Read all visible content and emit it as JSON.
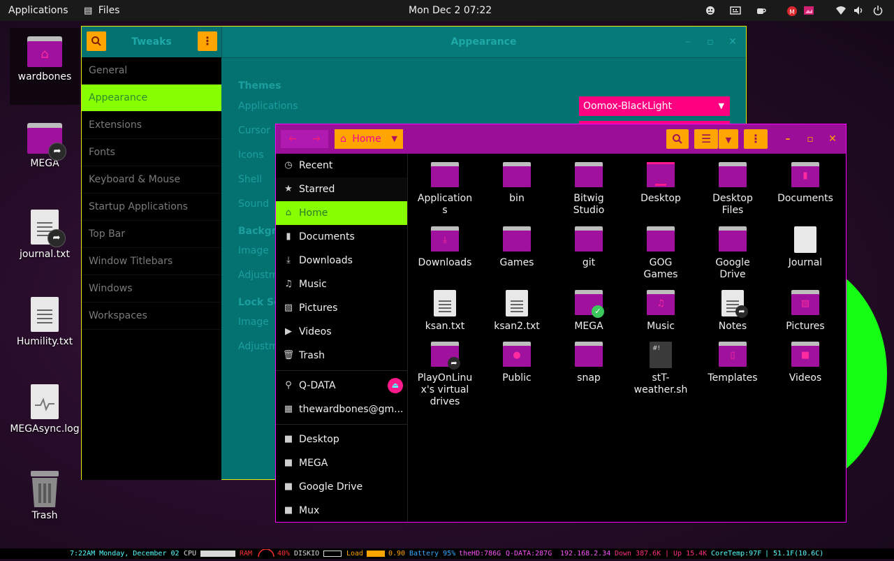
{
  "topbar": {
    "applications": "Applications",
    "files": "Files",
    "clock": "Mon Dec 2  07:22",
    "tray_icons": [
      "emoji-icon",
      "keyboard-icon",
      "coffee-icon",
      "mega-icon",
      "image-icon",
      "wifi-icon",
      "volume-icon",
      "power-icon"
    ]
  },
  "desktop": {
    "icons": [
      {
        "label": "wardbones",
        "kind": "home-folder"
      },
      {
        "label": "MEGA",
        "kind": "folder-link"
      },
      {
        "label": "journal.txt",
        "kind": "text-link"
      },
      {
        "label": "Humility.txt",
        "kind": "text"
      },
      {
        "label": "MEGAsync.log",
        "kind": "log"
      },
      {
        "label": "Trash",
        "kind": "trash"
      }
    ]
  },
  "tweaks": {
    "title": "Tweaks",
    "panel_title": "Appearance",
    "sidebar": [
      "General",
      "Appearance",
      "Extensions",
      "Fonts",
      "Keyboard & Mouse",
      "Startup Applications",
      "Top Bar",
      "Window Titlebars",
      "Windows",
      "Workspaces"
    ],
    "active_index": 1,
    "themes_header": "Themes",
    "rows": [
      "Applications",
      "Cursor",
      "Icons",
      "Shell",
      "Sound"
    ],
    "background_header": "Backgro",
    "background_rows": [
      "Image",
      "Adjustm"
    ],
    "lockscreen_header": "Lock Sc",
    "lockscreen_rows": [
      "Image",
      "Adjustm"
    ],
    "applications_theme": "Oomox-BlackLight"
  },
  "files": {
    "path_label": "Home",
    "sidebar": [
      {
        "label": "Recent",
        "icon": "clock-icon"
      },
      {
        "label": "Starred",
        "icon": "star-icon"
      },
      {
        "label": "Home",
        "icon": "home-icon",
        "active": true
      },
      {
        "label": "Documents",
        "icon": "document-icon"
      },
      {
        "label": "Downloads",
        "icon": "download-icon"
      },
      {
        "label": "Music",
        "icon": "music-icon"
      },
      {
        "label": "Pictures",
        "icon": "picture-icon"
      },
      {
        "label": "Videos",
        "icon": "video-icon"
      },
      {
        "label": "Trash",
        "icon": "trash-icon"
      },
      {
        "label": "Q-DATA",
        "icon": "drive-icon"
      },
      {
        "label": "thewardbones@gm...",
        "icon": "network-icon"
      },
      {
        "label": "Desktop",
        "icon": "folder-icon"
      },
      {
        "label": "MEGA",
        "icon": "folder-icon"
      },
      {
        "label": "Google Drive",
        "icon": "folder-icon"
      },
      {
        "label": "Mux",
        "icon": "folder-icon"
      }
    ],
    "grid": [
      {
        "label": "Application\ns",
        "kind": "folder"
      },
      {
        "label": "bin",
        "kind": "folder"
      },
      {
        "label": "Bitwig\nStudio",
        "kind": "folder"
      },
      {
        "label": "Desktop",
        "kind": "desktop"
      },
      {
        "label": "Desktop\nFiles",
        "kind": "folder"
      },
      {
        "label": "Documents",
        "kind": "folder-doc"
      },
      {
        "label": "Downloads",
        "kind": "folder-down"
      },
      {
        "label": "Games",
        "kind": "folder"
      },
      {
        "label": "git",
        "kind": "folder"
      },
      {
        "label": "GOG\nGames",
        "kind": "folder"
      },
      {
        "label": "Google\nDrive",
        "kind": "folder"
      },
      {
        "label": "Journal",
        "kind": "file-blank"
      },
      {
        "label": "ksan.txt",
        "kind": "file"
      },
      {
        "label": "ksan2.txt",
        "kind": "file"
      },
      {
        "label": "MEGA",
        "kind": "folder-check"
      },
      {
        "label": "Music",
        "kind": "folder-music"
      },
      {
        "label": "Notes",
        "kind": "file-link"
      },
      {
        "label": "Pictures",
        "kind": "folder-pic"
      },
      {
        "label": "PlayOnLinu\nx's virtual\ndrives",
        "kind": "folder-link"
      },
      {
        "label": "Public",
        "kind": "folder-user"
      },
      {
        "label": "snap",
        "kind": "folder"
      },
      {
        "label": "stT-\nweather.sh",
        "kind": "script"
      },
      {
        "label": "Templates",
        "kind": "folder-tpl"
      },
      {
        "label": "Videos",
        "kind": "folder-vid"
      }
    ]
  },
  "conky": {
    "time": "7:22AM Monday, December 02",
    "cpu": "CPU",
    "ram": "RAM",
    "ram_pct": "40%",
    "diskio": "DISKIO",
    "load": "Load",
    "load_val": "0.90",
    "battery": "Battery 95%",
    "hd": "theHD:786G",
    "qdata": "Q-DATA:287G",
    "ip": "192.168.2.34",
    "down": "Down 387.6K",
    "up": "| Up 15.4K",
    "coretemp": "CoreTemp:97F",
    "temp": "| 51.1F(10.6C)"
  },
  "colors": {
    "accent_orange": "#ffa500",
    "accent_magenta": "#9a0f98",
    "accent_green": "#88ff00",
    "teal": "#057272",
    "pink": "#ff0080"
  }
}
